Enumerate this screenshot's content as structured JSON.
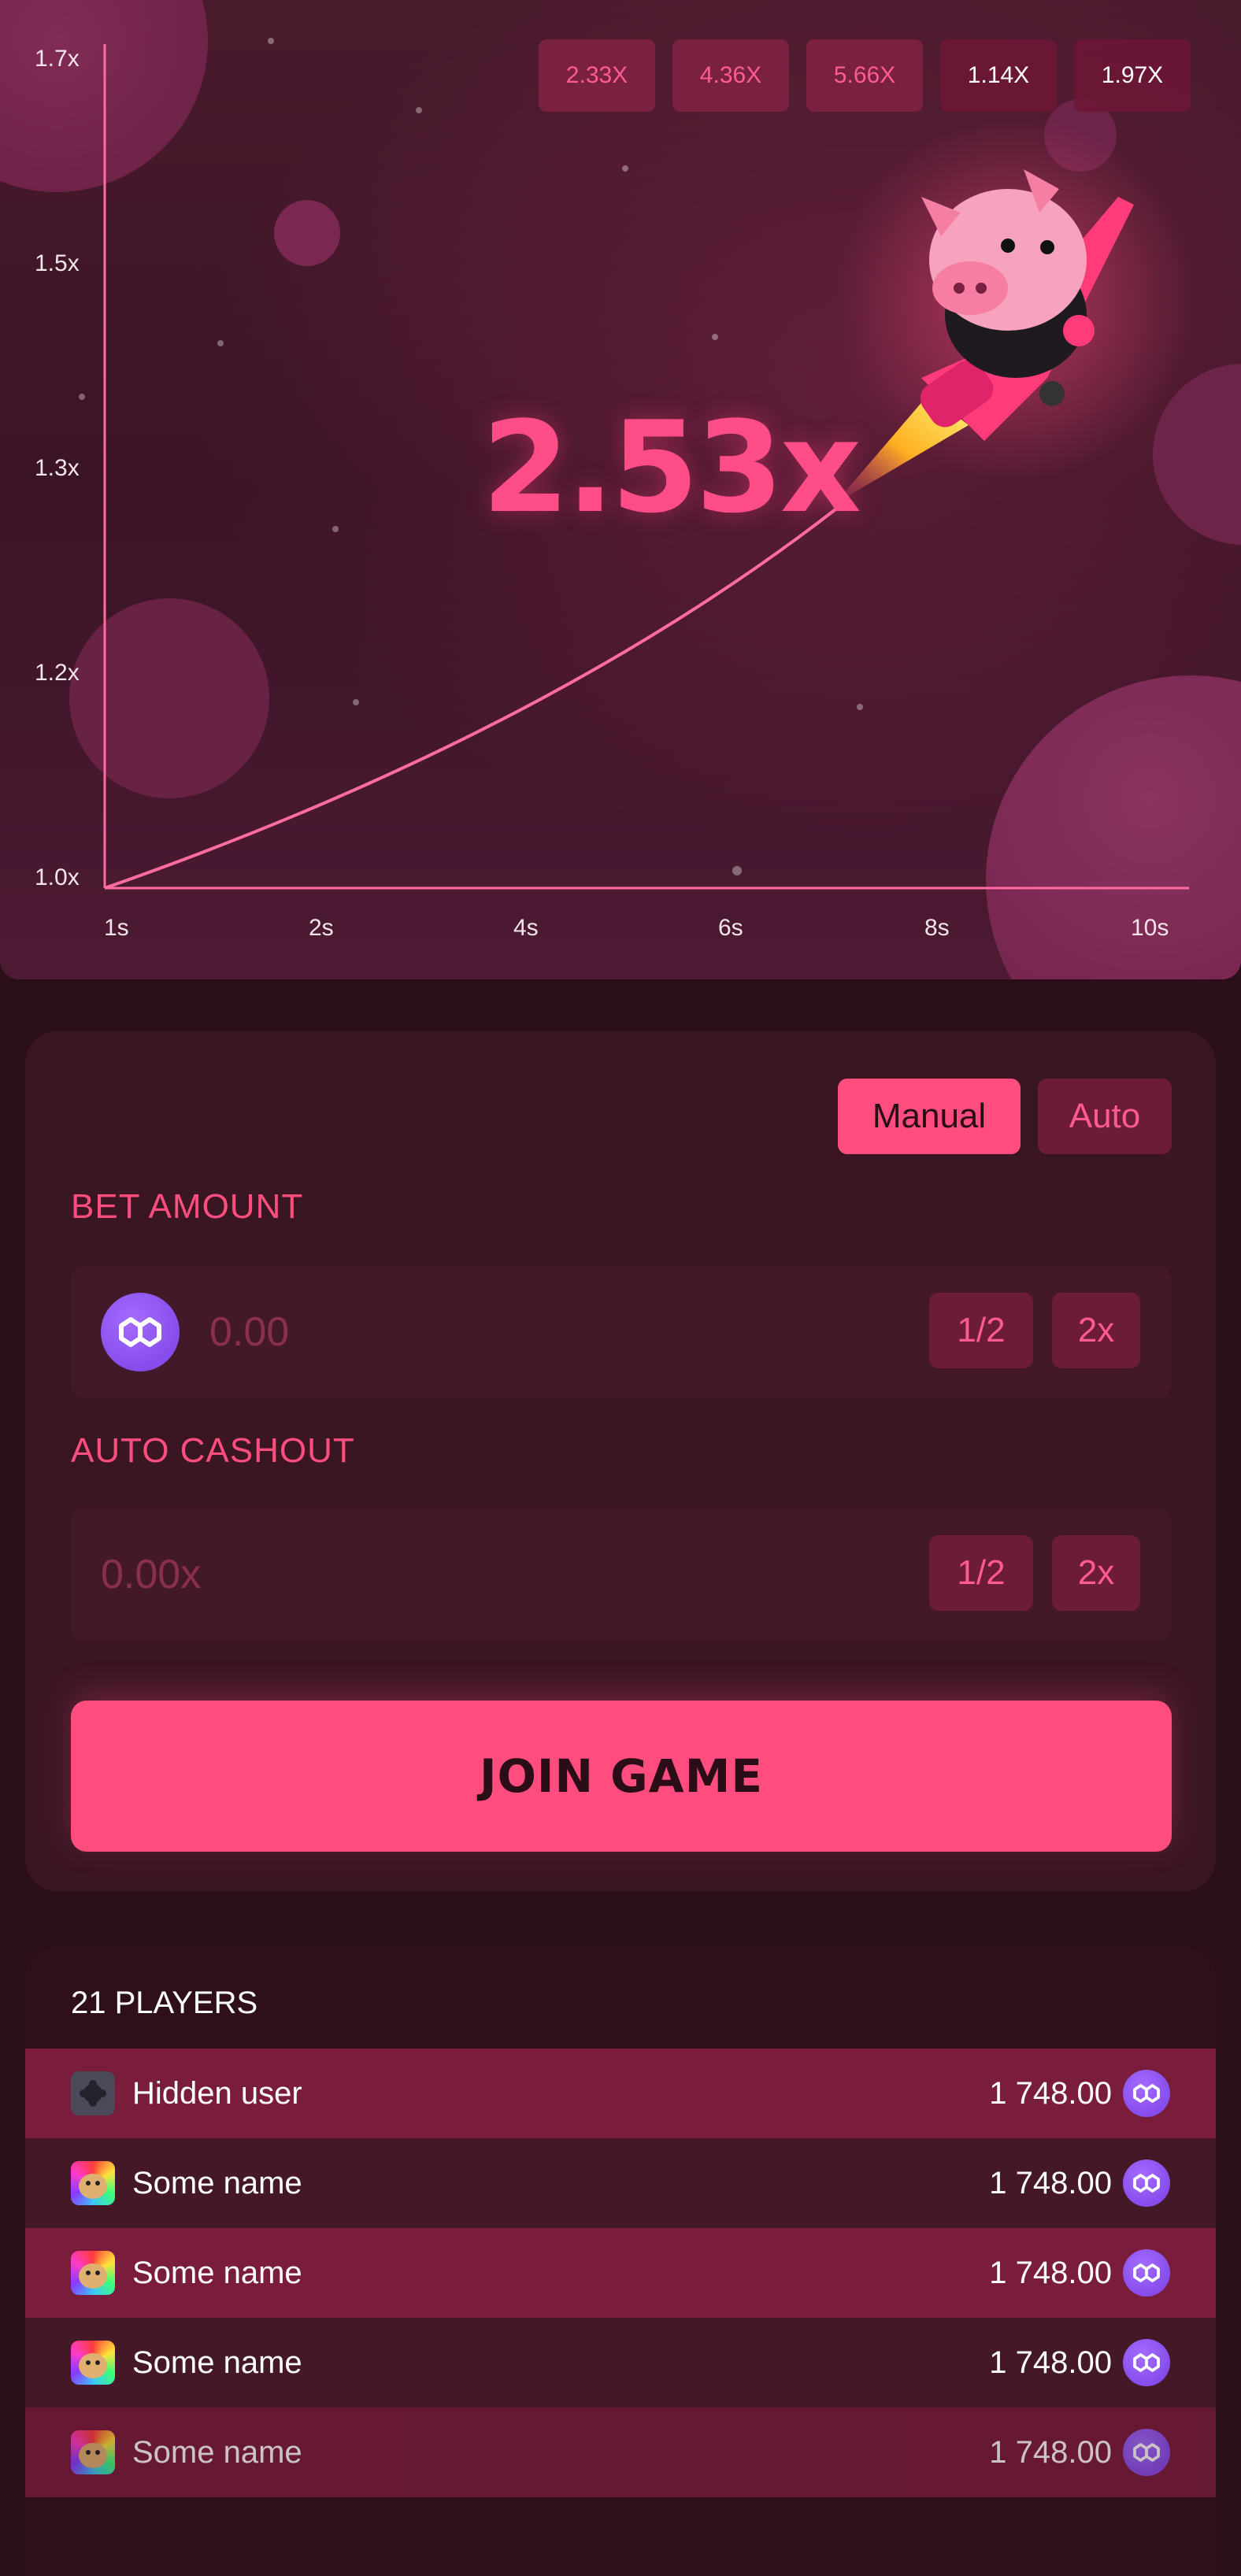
{
  "history": [
    "2.33X",
    "4.36X",
    "5.66X",
    "1.14X",
    "1.97X"
  ],
  "chart": {
    "y_ticks": [
      "1.7x",
      "1.5x",
      "1.3x",
      "1.2x",
      "1.0x"
    ],
    "x_ticks": [
      "1s",
      "2s",
      "4s",
      "6s",
      "8s",
      "10s"
    ],
    "multiplier": "2.53x"
  },
  "bet": {
    "mode_manual": "Manual",
    "mode_auto": "Auto",
    "bet_amount_label": "BET AMOUNT",
    "bet_amount_value": "0.00",
    "auto_cashout_label": "AUTO CASHOUT",
    "auto_cashout_value": "0.00x",
    "half_label": "1/2",
    "double_label": "2x",
    "join_label": "JOIN GAME"
  },
  "players": {
    "title": "21 PLAYERS",
    "rows": [
      {
        "name": "Hidden user",
        "amount": "1 748.00",
        "avatar": "hidden-user-icon"
      },
      {
        "name": "Some name",
        "amount": "1 748.00",
        "avatar": "doge-avatar"
      },
      {
        "name": "Some name",
        "amount": "1 748.00",
        "avatar": "doge-avatar"
      },
      {
        "name": "Some name",
        "amount": "1 748.00",
        "avatar": "doge-avatar"
      },
      {
        "name": "Some name",
        "amount": "1 748.00",
        "avatar": "doge-avatar"
      }
    ]
  },
  "colors": {
    "accent": "#ff4d80",
    "background": "#2a0f18",
    "coin": "#7b3fe4"
  }
}
